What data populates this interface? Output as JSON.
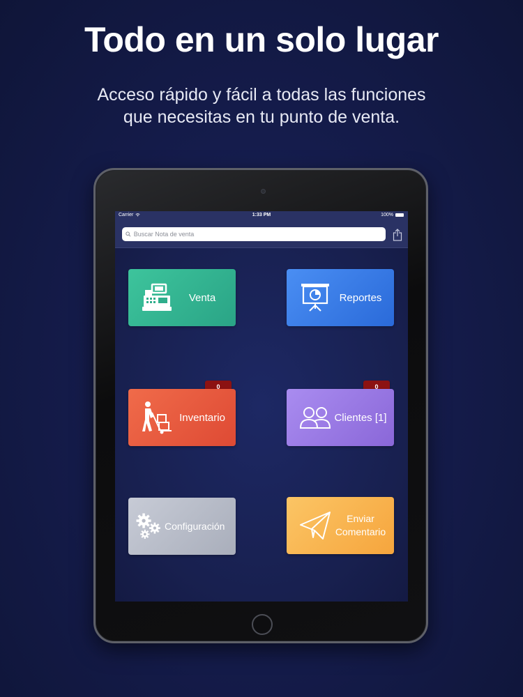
{
  "promo": {
    "title": "Todo en un solo lugar",
    "subtitle_line1": "Acceso rápido y fácil a todas las funciones",
    "subtitle_line2": "que necesitas en tu punto de venta."
  },
  "statusbar": {
    "carrier": "Carrier",
    "time": "1:33 PM",
    "battery": "100%"
  },
  "search": {
    "placeholder": "Buscar Nota de venta",
    "value": ""
  },
  "tiles": {
    "venta": {
      "label": "Venta",
      "icon": "cash-register-icon"
    },
    "reportes": {
      "label": "Reportes",
      "icon": "presentation-chart-icon"
    },
    "inventario": {
      "label": "Inventario",
      "icon": "hand-truck-icon",
      "badge": "0"
    },
    "clientes": {
      "label": "Clientes [1]",
      "icon": "users-icon",
      "badge": "0"
    },
    "configuracion": {
      "label": "Configuración",
      "icon": "gears-icon"
    },
    "enviar": {
      "label_line1": "Enviar",
      "label_line2": "Comentario",
      "icon": "paper-plane-icon"
    }
  },
  "colors": {
    "background": "#151c4c",
    "navbar": "#2a3264",
    "venta": "#34b892",
    "reportes": "#3a7ee6",
    "inventario": "#e85a3f",
    "clientes": "#9a7ae4",
    "configuracion": "#b8bcc8",
    "enviar": "#f8b54f",
    "badge": "#8c1212"
  }
}
